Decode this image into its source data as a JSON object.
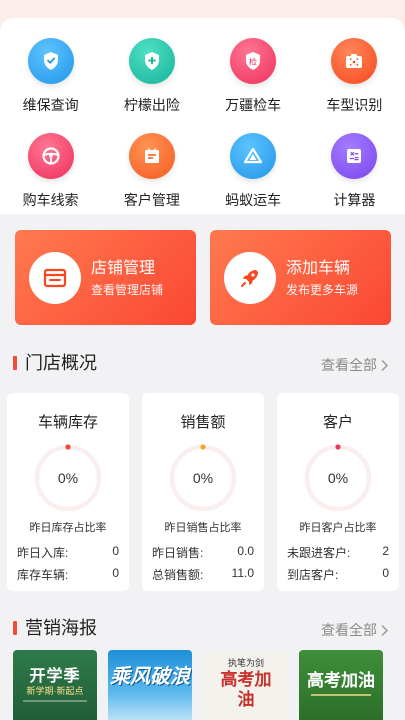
{
  "menu": [
    {
      "label": "维保查询",
      "icon": "shield-check-icon",
      "color": "#2fa8f0"
    },
    {
      "label": "柠檬出险",
      "icon": "shield-plus-icon",
      "color": "#22c1a8"
    },
    {
      "label": "万疆检车",
      "icon": "inspect-badge-icon",
      "color": "#f5456b"
    },
    {
      "label": "车型识别",
      "icon": "camera-scan-icon",
      "color": "#fa5b33"
    },
    {
      "label": "购车线索",
      "icon": "steering-wheel-icon",
      "color": "#f5456b"
    },
    {
      "label": "客户管理",
      "icon": "customer-calendar-icon",
      "color": "#fa6d2f"
    },
    {
      "label": "蚂蚁运车",
      "icon": "transport-triangle-icon",
      "color": "#2fa8f0"
    },
    {
      "label": "计算器",
      "icon": "calculator-icon",
      "color": "#8a5cf0"
    }
  ],
  "banners": [
    {
      "title": "店铺管理",
      "subtitle": "查看管理店铺",
      "icon": "store-icon"
    },
    {
      "title": "添加车辆",
      "subtitle": "发布更多车源",
      "icon": "rocket-icon"
    }
  ],
  "overview": {
    "title": "门店概况",
    "more": "查看全部",
    "cards": [
      {
        "title": "车辆库存",
        "value": "0%",
        "ratio": 0,
        "caption": "昨日库存占比率",
        "rows": [
          {
            "label": "昨日入库:",
            "value": "0"
          },
          {
            "label": "库存车辆:",
            "value": "0"
          }
        ]
      },
      {
        "title": "销售额",
        "value": "0%",
        "ratio": 0,
        "caption": "昨日销售占比率",
        "rows": [
          {
            "label": "昨日销售:",
            "value": "0.0"
          },
          {
            "label": "总销售额:",
            "value": "11.0"
          }
        ]
      },
      {
        "title": "客户",
        "value": "0%",
        "ratio": 0,
        "caption": "昨日客户占比率",
        "rows": [
          {
            "label": "未跟进客户:",
            "value": "2"
          },
          {
            "label": "到店客户:",
            "value": "0"
          }
        ]
      }
    ]
  },
  "marketing": {
    "title": "营销海报",
    "more": "查看全部",
    "posters": [
      {
        "title": "开学季",
        "subtitle": "新学期·新起点"
      },
      {
        "title": "乘风破浪",
        "subtitle": ""
      },
      {
        "title": "高考加油",
        "subtitle": "执笔为剑"
      },
      {
        "title": "高考加油",
        "subtitle": ""
      }
    ]
  },
  "colors": {
    "accent": "#f24b38",
    "ring_track": "#fbeeee",
    "ring_dot": "#f24b38"
  }
}
